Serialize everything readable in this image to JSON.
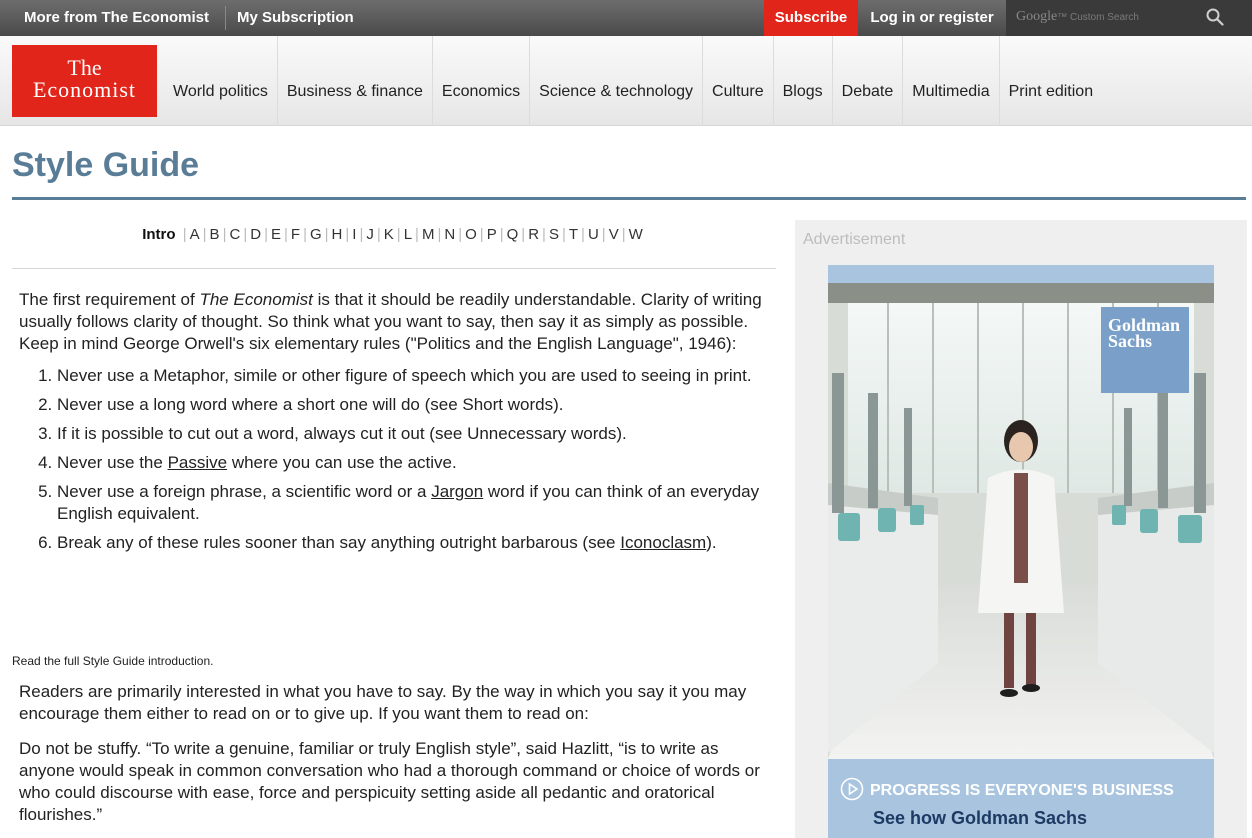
{
  "topbar": {
    "more": "More from The Economist",
    "subscription": "My Subscription",
    "subscribe": "Subscribe",
    "login": "Log in or register",
    "search_brand": "Google",
    "search_hint": "Custom Search"
  },
  "logo": {
    "line1": "The",
    "line2": "Economist"
  },
  "nav": [
    "World politics",
    "Business & finance",
    "Economics",
    "Science & technology",
    "Culture",
    "Blogs",
    "Debate",
    "Multimedia",
    "Print edition"
  ],
  "page_title": "Style Guide",
  "alphabet": {
    "intro": "Intro",
    "letters": [
      "A",
      "B",
      "C",
      "D",
      "E",
      "F",
      "G",
      "H",
      "I",
      "J",
      "K",
      "L",
      "M",
      "N",
      "O",
      "P",
      "Q",
      "R",
      "S",
      "T",
      "U",
      "V",
      "W"
    ]
  },
  "content": {
    "intro_part1": "The first requirement of ",
    "intro_em": "The Economist",
    "intro_part2": " is that it should be readily understandable. Clarity of writing usually follows clarity of thought. So think what you want to say, then say it as simply as possible. Keep in mind George Orwell's six elementary rules (\"Politics and the English Language\", 1946):",
    "rules": [
      {
        "pre": "Never use a Metaphor, simile or other figure of speech which you are used to seeing in print.",
        "link": "",
        "post": ""
      },
      {
        "pre": "Never use a long word where a short one will do (see Short words).",
        "link": "",
        "post": ""
      },
      {
        "pre": "If it is possible to cut out a word, always cut it out (see Unnecessary words).",
        "link": "",
        "post": ""
      },
      {
        "pre": "Never use the ",
        "link": "Passive",
        "post": " where you can use the active."
      },
      {
        "pre": "Never use a foreign phrase, a scientific word or a ",
        "link": "Jargon",
        "post": " word if you can think of an everyday English equivalent."
      },
      {
        "pre": "Break any of these rules sooner than say anything outright barbarous (see ",
        "link": "Iconoclasm",
        "post": ")."
      }
    ],
    "read_full": "Read the full Style Guide introduction.",
    "para2": "Readers are primarily interested in what you have to say. By the way in which you say it you may encourage them either to read on or to give up. If you want them to read on:",
    "para3": "Do not be stuffy. “To write a genuine, familiar or truly English style”, said Hazlitt, “is to write as anyone would speak in common conversation who had a thorough command or choice of words or who could discourse with ease, force and perspicuity setting aside all pedantic and oratorical flourishes.”"
  },
  "ad": {
    "label": "Advertisement",
    "gs_line1": "Goldman",
    "gs_line2": "Sachs",
    "progress": "PROGRESS IS EVERYONE'S BUSINESS",
    "cta": "See how Goldman Sachs"
  },
  "colors": {
    "brand_red": "#e1251b",
    "title_blue": "#5a7d97",
    "ad_blue": "#a9c4df"
  }
}
